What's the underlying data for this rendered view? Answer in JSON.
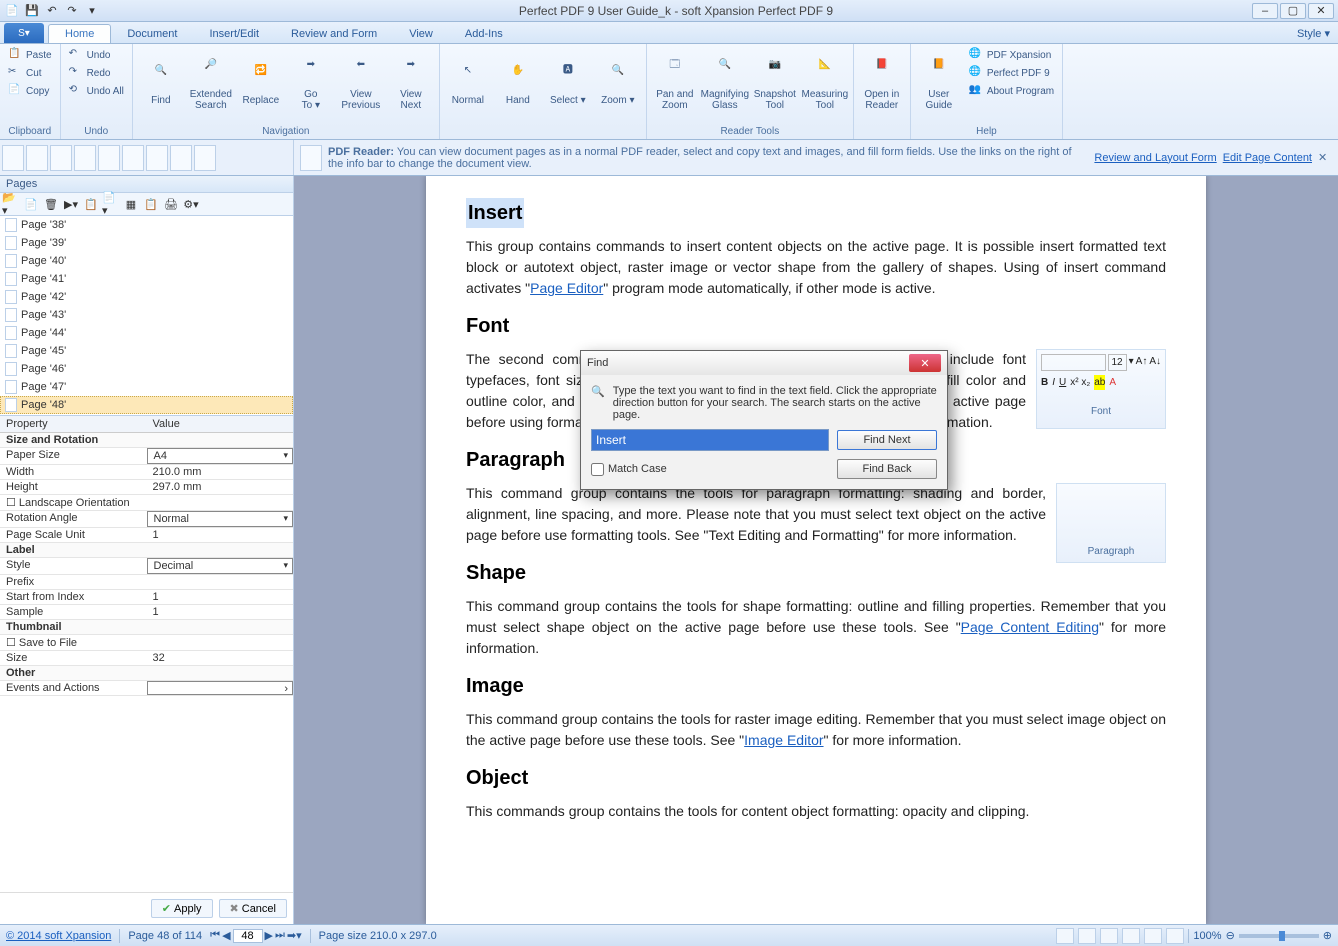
{
  "titlebar": {
    "title": "Perfect PDF 9 User Guide_k - soft Xpansion Perfect PDF 9"
  },
  "tabs": {
    "home": "Home",
    "document": "Document",
    "insert_edit": "Insert/Edit",
    "review_form": "Review and Form",
    "view": "View",
    "addins": "Add-Ins",
    "style": "Style"
  },
  "ribbon": {
    "clipboard": {
      "paste": "Paste",
      "cut": "Cut",
      "copy": "Copy",
      "label": "Clipboard"
    },
    "undo": {
      "undo": "Undo",
      "redo": "Redo",
      "undo_all": "Undo All",
      "label": "Undo"
    },
    "navigation": {
      "find": "Find",
      "extsearch_l1": "Extended",
      "extsearch_l2": "Search",
      "replace": "Replace",
      "goto_l1": "Go",
      "goto_l2": "To",
      "vprev_l1": "View",
      "vprev_l2": "Previous",
      "vnext_l1": "View",
      "vnext_l2": "Next",
      "label": "Navigation"
    },
    "normal": "Normal",
    "hand": "Hand",
    "select": "Select",
    "zoom": "Zoom",
    "reader_tools": {
      "panzoom_l1": "Pan and",
      "panzoom_l2": "Zoom",
      "mag_l1": "Magnifying",
      "mag_l2": "Glass",
      "snap_l1": "Snapshot",
      "snap_l2": "Tool",
      "meas_l1": "Measuring",
      "meas_l2": "Tool",
      "label": "Reader Tools"
    },
    "open_reader_l1": "Open in",
    "open_reader_l2": "Reader",
    "help": {
      "user_guide_l1": "User",
      "user_guide_l2": "Guide",
      "pdfx": "PDF Xpansion",
      "ppdf": "Perfect PDF 9",
      "about": "About Program",
      "label": "Help"
    }
  },
  "infobar": {
    "prefix": "PDF Reader:",
    "text": "You can view document pages as in a normal PDF reader, select and copy text and images, and fill form fields. Use the links on the right of the info bar to change the document view.",
    "link1": "Review and Layout Form",
    "link2": "Edit Page Content"
  },
  "sidebar": {
    "title": "Pages",
    "pages": [
      "Page '38'",
      "Page '39'",
      "Page '40'",
      "Page '41'",
      "Page '42'",
      "Page '43'",
      "Page '44'",
      "Page '45'",
      "Page '46'",
      "Page '47'",
      "Page '48'"
    ],
    "active_index": 10,
    "props_head": {
      "c1": "Property",
      "c2": "Value"
    },
    "groups": {
      "size_rot": "Size and Rotation",
      "label": "Label",
      "thumb": "Thumbnail",
      "other": "Other"
    },
    "props": {
      "paper_size": {
        "k": "Paper Size",
        "v": "A4"
      },
      "width": {
        "k": "Width",
        "v": "210.0 mm"
      },
      "height": {
        "k": "Height",
        "v": "297.0 mm"
      },
      "landscape": {
        "k": "Landscape Orientation",
        "v": ""
      },
      "rotation": {
        "k": "Rotation Angle",
        "v": "Normal"
      },
      "scale_unit": {
        "k": "Page Scale Unit",
        "v": "1"
      },
      "style": {
        "k": "Style",
        "v": "Decimal"
      },
      "prefix": {
        "k": "Prefix",
        "v": ""
      },
      "start_index": {
        "k": "Start from Index",
        "v": "1"
      },
      "sample": {
        "k": "Sample",
        "v": "1"
      },
      "save_file": {
        "k": "Save to File",
        "v": ""
      },
      "size": {
        "k": "Size",
        "v": "32"
      },
      "events": {
        "k": "Events and Actions",
        "v": ""
      }
    },
    "apply": "Apply",
    "cancel": "Cancel"
  },
  "doc": {
    "h_insert": "Insert",
    "p_insert_1": "This group contains commands to insert content objects on the active page. It is possible insert formatted text block or autotext object, raster image or vector shape from the gallery of shapes. Using of insert command activates \"",
    "p_insert_link": "Page Editor",
    "p_insert_2": "\" program mode automatically, if other mode is active.",
    "h_font": "Font",
    "p_font": "The second command group contains text format enhancing tools that include font typefaces, font size, font styles (bold, italic, underline, strikethrough), font fill color and outline color, and more. Please note that you must select text object on the active page before using formatting tools. See \"Text Editing and Formatting\" for more information.",
    "h_para": "Paragraph",
    "p_para": "This command group contains the tools for paragraph formatting: shading and border, alignment, line spacing, and more. Please note that you must select text object on the active page before use formatting tools. See \"Text Editing and Formatting\" for more information.",
    "para_label": "Paragraph",
    "font_label": "Font",
    "font_size": "12",
    "h_shape": "Shape",
    "p_shape_1": "This command group contains the tools for shape formatting: outline and filling properties. Remember that you must select shape object on the active page before use these tools. See \"",
    "p_shape_link": "Page Content Editing",
    "p_shape_2": "\" for more information.",
    "h_image": "Image",
    "p_image_1": "This command group contains the tools for raster image editing. Remember that you must select image object on the active page before use these tools. See \"",
    "p_image_link": "Image Editor",
    "p_image_2": "\" for more information.",
    "h_object": "Object",
    "p_object": "This commands group contains the tools for content object formatting: opacity and clipping."
  },
  "find_dialog": {
    "title": "Find",
    "instruction": "Type the text you want to find in the text field. Click the appropriate direction button for your search. The search starts on the active page.",
    "value": "Insert",
    "match_case": "Match Case",
    "find_next": "Find Next",
    "find_back": "Find Back"
  },
  "status": {
    "copyright": "© 2014 soft Xpansion",
    "page_of": "Page 48 of 114",
    "page_num": "48",
    "page_size": "Page size 210.0 x 297.0",
    "zoom": "100%"
  }
}
